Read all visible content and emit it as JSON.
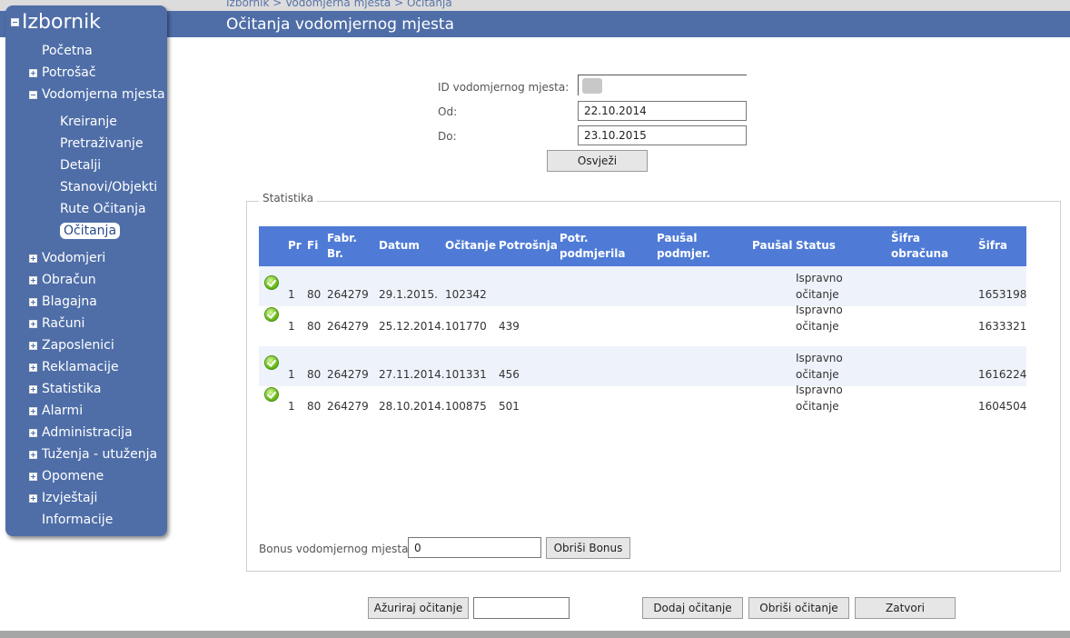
{
  "breadcrumb": "Izbornik > Vodomjerna mjesta > Očitanja",
  "page_title": "Očitanja vodomjernog mjesta",
  "sidebar": {
    "title": "Izbornik",
    "items": [
      {
        "label": "Početna"
      },
      {
        "label": "Potrošač",
        "toggle": "plus"
      },
      {
        "label": "Vodomjerna mjesta",
        "toggle": "minus"
      },
      {
        "label": "Kreiranje"
      },
      {
        "label": "Pretraživanje"
      },
      {
        "label": "Detalji"
      },
      {
        "label": "Stanovi/Objekti"
      },
      {
        "label": "Rute Očitanja"
      },
      {
        "label": "Očitanja",
        "active": true
      },
      {
        "label": "Vodomjeri",
        "toggle": "plus"
      },
      {
        "label": "Obračun",
        "toggle": "plus"
      },
      {
        "label": "Blagajna",
        "toggle": "plus"
      },
      {
        "label": "Računi",
        "toggle": "plus"
      },
      {
        "label": "Zaposlenici",
        "toggle": "plus"
      },
      {
        "label": "Reklamacije",
        "toggle": "plus"
      },
      {
        "label": "Statistika",
        "toggle": "plus"
      },
      {
        "label": "Alarmi",
        "toggle": "plus"
      },
      {
        "label": "Administracija",
        "toggle": "plus"
      },
      {
        "label": "Tuženja - utuženja",
        "toggle": "plus"
      },
      {
        "label": "Opomene",
        "toggle": "plus"
      },
      {
        "label": "Izvještaji",
        "toggle": "plus"
      },
      {
        "label": "Informacije"
      }
    ]
  },
  "form": {
    "id_label": "ID vodomjernog mjesta:",
    "od_label": "Od:",
    "od_value": "22.10.2014",
    "do_label": "Do:",
    "do_value": "23.10.2015",
    "refresh_label": "Osvježi"
  },
  "stats": {
    "legend": "Statistika",
    "columns": {
      "pr": "Pr",
      "fi": "Fi",
      "fabr_1": "Fabr.",
      "fabr_2": "Br.",
      "datum": "Datum",
      "ocitanje": "Očitanje",
      "potrosnja": "Potrošnja",
      "potr_1": "Potr.",
      "potr_2": "podmjerila",
      "pausal_p_1": "Paušal",
      "pausal_p_2": "podmjer.",
      "pausal": "Paušal",
      "status": "Status",
      "sifra_obr_1": "Šifra",
      "sifra_obr_2": "obračuna",
      "sifra": "Šifra"
    },
    "rows": [
      {
        "icon": "checkmark-icon",
        "pr": "1",
        "fi": "80",
        "fabr": "264279",
        "datum": "29.1.2015.",
        "ocitanje": "102342",
        "potrosnja": "",
        "status_1": "Ispravno",
        "status_2": "očitanje",
        "sifra": "1653198"
      },
      {
        "icon": "checkmark-icon",
        "pr": "1",
        "fi": "80",
        "fabr": "264279",
        "datum": "25.12.2014.",
        "ocitanje": "101770",
        "potrosnja": "439",
        "status_1": "Ispravno",
        "status_2": "očitanje",
        "sifra": "1633321"
      },
      {
        "icon": "checkmark-icon",
        "pr": "1",
        "fi": "80",
        "fabr": "264279",
        "datum": "27.11.2014.",
        "ocitanje": "101331",
        "potrosnja": "456",
        "status_1": "Ispravno",
        "status_2": "očitanje",
        "sifra": "1616224"
      },
      {
        "icon": "checkmark-icon",
        "pr": "1",
        "fi": "80",
        "fabr": "264279",
        "datum": "28.10.2014.",
        "ocitanje": "100875",
        "potrosnja": "501",
        "status_1": "Ispravno",
        "status_2": "očitanje",
        "sifra": "1604504"
      }
    ],
    "bonus_label": "Bonus vodomjernog mjesta",
    "bonus_value": "0",
    "bonus_delete_label": "Obriši Bonus"
  },
  "footer": {
    "update_label": "Ažuriraj očitanje",
    "update_value": "",
    "add_label": "Dodaj očitanje",
    "delete_label": "Obriši očitanje",
    "close_label": "Zatvori"
  },
  "colors": {
    "brand_blue": "#4f6ea8",
    "header_blue": "#4f7bd6"
  }
}
